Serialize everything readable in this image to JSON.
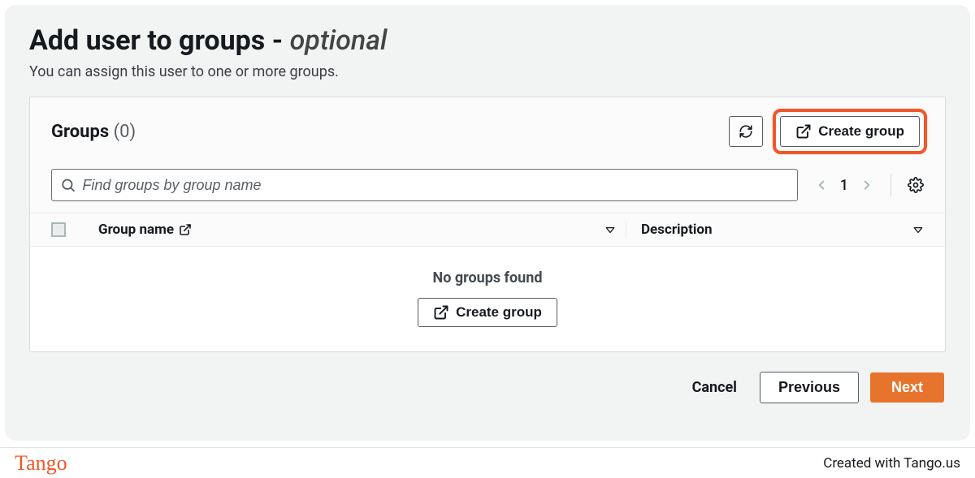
{
  "header": {
    "title_main": "Add user to groups",
    "title_sep": " - ",
    "title_optional": "optional",
    "subtitle": "You can assign this user to one or more groups."
  },
  "panel": {
    "title": "Groups",
    "count": "(0)",
    "create_group_label": "Create group"
  },
  "search": {
    "placeholder": "Find groups by group name"
  },
  "pagination": {
    "page": "1"
  },
  "table": {
    "col_group_name": "Group name",
    "col_description": "Description"
  },
  "empty": {
    "message": "No groups found",
    "create_group_label": "Create group"
  },
  "nav": {
    "cancel": "Cancel",
    "previous": "Previous",
    "next": "Next"
  },
  "footer": {
    "logo": "Tango",
    "credit": "Created with Tango.us"
  }
}
